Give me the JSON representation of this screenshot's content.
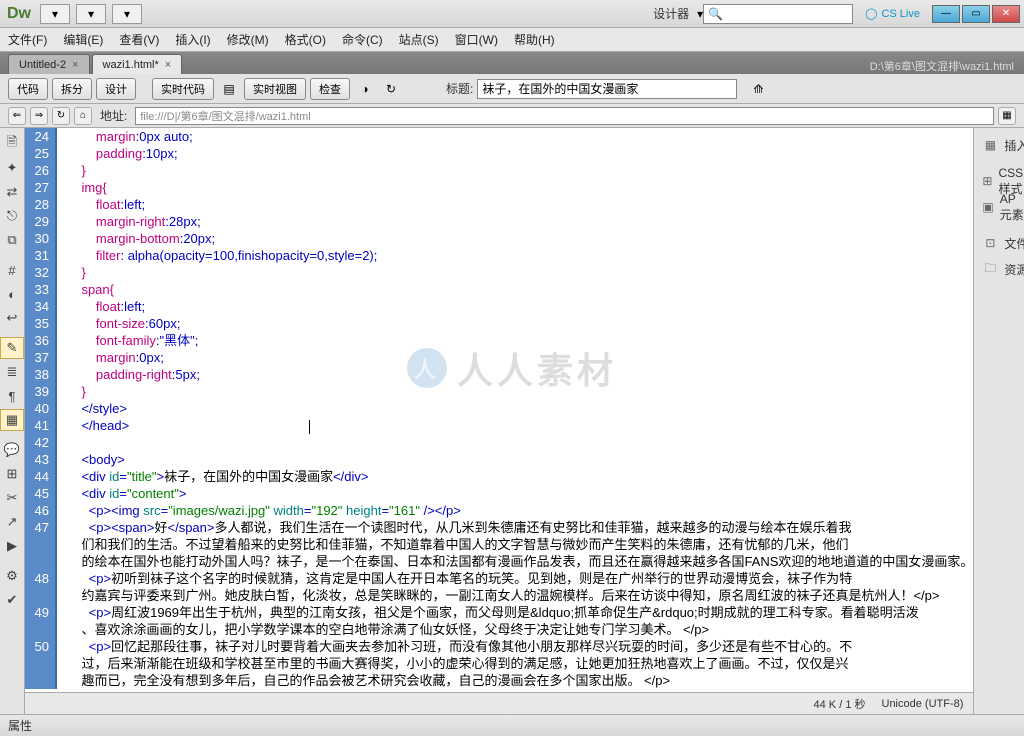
{
  "app": {
    "logo": "Dw",
    "designer_label": "设计器",
    "cslive": "CS Live"
  },
  "menus": [
    "文件(F)",
    "编辑(E)",
    "查看(V)",
    "插入(I)",
    "修改(M)",
    "格式(O)",
    "命令(C)",
    "站点(S)",
    "窗口(W)",
    "帮助(H)"
  ],
  "tabs": [
    {
      "label": "Untitled-2",
      "close": "×"
    },
    {
      "label": "wazi1.html*",
      "close": "×"
    }
  ],
  "filepath": "D:\\第6章\\图文混排\\wazi1.html",
  "toolbar": {
    "code": "代码",
    "split": "拆分",
    "design": "设计",
    "live_code": "实时代码",
    "live_view": "实时视图",
    "inspect": "检查",
    "title_label": "标题:",
    "title_value": "袜子，在国外的中国女漫画家"
  },
  "addressbar": {
    "label": "地址:",
    "value": "file:///D|/第6章/图文混排/wazi1.html"
  },
  "right_panel": {
    "insert": "插入",
    "css": "CSS样式",
    "ap": "AP 元素",
    "files": "文件",
    "assets": "资源"
  },
  "status": {
    "size": "44 K / 1 秒",
    "encoding": "Unicode (UTF-8)"
  },
  "properties": {
    "label": "属性"
  },
  "watermark": "人人素材",
  "code": [
    {
      "n": 24,
      "t": "css",
      "s": "        margin:0px auto;"
    },
    {
      "n": 25,
      "t": "css",
      "s": "        padding:10px;"
    },
    {
      "n": 26,
      "t": "css",
      "s": "    }"
    },
    {
      "n": 27,
      "t": "sel",
      "s": "    img{"
    },
    {
      "n": 28,
      "t": "css",
      "s": "        float:left;"
    },
    {
      "n": 29,
      "t": "css",
      "s": "        margin-right:28px;"
    },
    {
      "n": 30,
      "t": "css",
      "s": "        margin-bottom:20px;"
    },
    {
      "n": 31,
      "t": "css",
      "s": "        filter: alpha(opacity=100,finishopacity=0,style=2);"
    },
    {
      "n": 32,
      "t": "css",
      "s": "    }"
    },
    {
      "n": 33,
      "t": "sel",
      "s": "    span{"
    },
    {
      "n": 34,
      "t": "css",
      "s": "        float:left;"
    },
    {
      "n": 35,
      "t": "css",
      "s": "        font-size:60px;"
    },
    {
      "n": 36,
      "t": "cssq",
      "s": "        font-family:\"黑体\";"
    },
    {
      "n": 37,
      "t": "css",
      "s": "        margin:0px;"
    },
    {
      "n": 38,
      "t": "css",
      "s": "        padding-right:5px;"
    },
    {
      "n": 39,
      "t": "css",
      "s": "    }"
    },
    {
      "n": 40,
      "t": "tag",
      "s": "    </style>"
    },
    {
      "n": 41,
      "t": "tag",
      "s": "    </head>",
      "caret": true
    },
    {
      "n": 42,
      "t": "txt",
      "s": ""
    },
    {
      "n": 43,
      "t": "tag",
      "s": "    <body>"
    },
    {
      "n": 44,
      "t": "html",
      "s": "    <div id=\"title\">袜子，在国外的中国女漫画家</div>"
    },
    {
      "n": 45,
      "t": "html",
      "s": "    <div id=\"content\">"
    },
    {
      "n": 46,
      "t": "html",
      "s": "      <p><img src=\"images/wazi.jpg\" width=\"192\" height=\"161\" /></p>"
    },
    {
      "n": 47,
      "t": "html",
      "s": "      <p><span>好</span>多人都说，我们生活在一个读图时代，从几米到朱德庸还有史努比和佳菲猫，越来越多的动漫与绘本在娱乐着我"
    },
    {
      "n": "",
      "t": "txt",
      "s": "    们和我们的生活。不过望着船来的史努比和佳菲猫，不知道靠着中国人的文字智慧与微妙而产生笑料的朱德庸，还有忧郁的几米，他们"
    },
    {
      "n": "",
      "t": "txt",
      "s": "    的绘本在国外也能打动外国人吗？袜子，是一个在泰国、日本和法国都有漫画作品发表，而且还在赢得越来越多各国FANS欢迎的地地道道的中国女漫画家。"
    },
    {
      "n": "",
      "t": "txt",
      "s": ""
    },
    {
      "n": 48,
      "t": "html",
      "s": "      <p>初听到袜子这个名字的时候就猜，这肯定是中国人在开日本笔名的玩笑。见到她，则是在广州举行的世界动漫博览会，袜子作为特"
    },
    {
      "n": "",
      "t": "txt",
      "s": "    约嘉宾与评委来到广州。她皮肤白皙，化淡妆，总是笑眯眯的，一副江南女人的温婉模样。后来在访谈中得知，原名周红波的袜子还真是杭州人！</p>"
    },
    {
      "n": 49,
      "t": "html",
      "s": "      <p>周红波1969年出生于杭州，典型的江南女孩，祖父是个画家，而父母则是&ldquo;抓革命促生产&rdquo;时期成就的理工科专家。看着聪明活泼"
    },
    {
      "n": "",
      "t": "txt",
      "s": "    、喜欢涂涂画画的女儿，把小学数学课本的空白地带涂满了仙女妖怪，父母终于决定让她专门学习美术。 </p>"
    },
    {
      "n": 50,
      "t": "html",
      "s": "      <p>回忆起那段往事，袜子对儿时要背着大画夹去参加补习班，而没有像其他小朋友那样尽兴玩耍的时间，多少还是有些不甘心的。不"
    },
    {
      "n": "",
      "t": "txt",
      "s": "    过，后来渐渐能在班级和学校甚至市里的书画大赛得奖，小小的虚荣心得到的满足感，让她更加狂热地喜欢上了画画。不过，仅仅是兴"
    },
    {
      "n": "",
      "t": "txt",
      "s": "    趣而已，完全没有想到多年后，自己的作品会被艺术研究会收藏，自己的漫画会在多个国家出版。 </p>"
    }
  ]
}
